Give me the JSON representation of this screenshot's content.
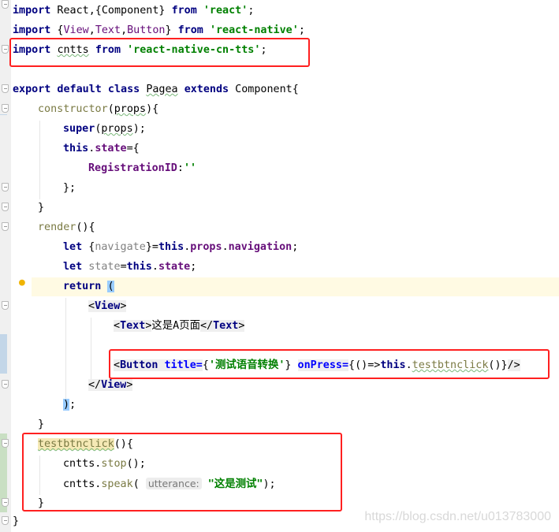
{
  "colors": {
    "keyword": "#000080",
    "string": "#008000",
    "field": "#660e7a",
    "highlight_box": "#ff2020",
    "current_line": "#fffae3"
  },
  "icons": {
    "gutter_hint": "lightbulb-icon",
    "fold": "fold-marker-icon"
  },
  "lines": [
    {
      "indent": 0,
      "tokens": [
        {
          "t": "import",
          "c": "kw"
        },
        {
          "t": " React,{Component} "
        },
        {
          "t": "from",
          "c": "kw"
        },
        {
          "t": " "
        },
        {
          "t": "'react'",
          "c": "str"
        },
        {
          "t": ";"
        }
      ]
    },
    {
      "indent": 0,
      "tokens": [
        {
          "t": "import",
          "c": "kw"
        },
        {
          "t": " {"
        },
        {
          "t": "View",
          "c": "cls"
        },
        {
          "t": ","
        },
        {
          "t": "Text",
          "c": "cls"
        },
        {
          "t": ","
        },
        {
          "t": "Button",
          "c": "cls"
        },
        {
          "t": "} "
        },
        {
          "t": "from",
          "c": "kw"
        },
        {
          "t": " "
        },
        {
          "t": "'react-native'",
          "c": "str"
        },
        {
          "t": ";"
        }
      ]
    },
    {
      "indent": 0,
      "tokens": [
        {
          "t": "import",
          "c": "kw"
        },
        {
          "t": " "
        },
        {
          "t": "cntts",
          "c": "und"
        },
        {
          "t": " "
        },
        {
          "t": "from",
          "c": "kw"
        },
        {
          "t": " "
        },
        {
          "t": "'react-native-cn-tts'",
          "c": "str"
        },
        {
          "t": ";"
        }
      ]
    },
    {
      "indent": 0,
      "tokens": []
    },
    {
      "indent": 0,
      "tokens": [
        {
          "t": "export default class",
          "c": "kw"
        },
        {
          "t": " "
        },
        {
          "t": "Pagea",
          "c": "und"
        },
        {
          "t": " "
        },
        {
          "t": "extends",
          "c": "kw"
        },
        {
          "t": " Component{"
        }
      ]
    },
    {
      "indent": 1,
      "tokens": [
        {
          "t": "constructor",
          "c": "mth"
        },
        {
          "t": "("
        },
        {
          "t": "props",
          "c": "und"
        },
        {
          "t": "){"
        }
      ]
    },
    {
      "indent": 2,
      "tokens": [
        {
          "t": "super",
          "c": "kw"
        },
        {
          "t": "("
        },
        {
          "t": "props",
          "c": "und"
        },
        {
          "t": ");"
        }
      ]
    },
    {
      "indent": 2,
      "tokens": [
        {
          "t": "this",
          "c": "kw"
        },
        {
          "t": "."
        },
        {
          "t": "state",
          "c": "fld"
        },
        {
          "t": "={"
        }
      ]
    },
    {
      "indent": 3,
      "tokens": [
        {
          "t": "RegistrationID",
          "c": "fld"
        },
        {
          "t": ":"
        },
        {
          "t": "''",
          "c": "str"
        }
      ]
    },
    {
      "indent": 2,
      "tokens": [
        {
          "t": "};"
        }
      ]
    },
    {
      "indent": 1,
      "tokens": [
        {
          "t": "}"
        }
      ]
    },
    {
      "indent": 1,
      "tokens": [
        {
          "t": "render",
          "c": "mth"
        },
        {
          "t": "(){"
        }
      ]
    },
    {
      "indent": 2,
      "tokens": [
        {
          "t": "let",
          "c": "kw"
        },
        {
          "t": " {"
        },
        {
          "t": "navigate",
          "c": "par"
        },
        {
          "t": "}="
        },
        {
          "t": "this",
          "c": "kw"
        },
        {
          "t": "."
        },
        {
          "t": "props",
          "c": "fld"
        },
        {
          "t": "."
        },
        {
          "t": "navigation",
          "c": "fld"
        },
        {
          "t": ";"
        }
      ]
    },
    {
      "indent": 2,
      "tokens": [
        {
          "t": "let",
          "c": "kw"
        },
        {
          "t": " "
        },
        {
          "t": "state",
          "c": "par"
        },
        {
          "t": "="
        },
        {
          "t": "this",
          "c": "kw"
        },
        {
          "t": "."
        },
        {
          "t": "state",
          "c": "fld"
        },
        {
          "t": ";"
        }
      ]
    },
    {
      "indent": 2,
      "tokens": [
        {
          "t": "return",
          "c": "kw"
        },
        {
          "t": " "
        },
        {
          "t": "(",
          "c": "brk"
        }
      ]
    },
    {
      "indent": 3,
      "tokens": [
        {
          "t": "<",
          "c": "tag"
        },
        {
          "t": "View",
          "c": "tagn"
        },
        {
          "t": ">",
          "c": "tag"
        }
      ]
    },
    {
      "indent": 4,
      "tokens": [
        {
          "t": "<",
          "c": "tag"
        },
        {
          "t": "Text",
          "c": "tagn"
        },
        {
          "t": ">",
          "c": "tag"
        },
        {
          "t": "这是A页面"
        },
        {
          "t": "</",
          "c": "tag"
        },
        {
          "t": "Text",
          "c": "tagn"
        },
        {
          "t": ">",
          "c": "tag"
        }
      ]
    },
    {
      "indent": 0,
      "tokens": []
    },
    {
      "indent": 4,
      "tokens": [
        {
          "t": "<",
          "c": "tag"
        },
        {
          "t": "Button",
          "c": "tagn"
        },
        {
          "t": " ",
          "c": "tag"
        },
        {
          "t": "title=",
          "c": "attr"
        },
        {
          "t": "{"
        },
        {
          "t": "'测试语音转换'",
          "c": "str"
        },
        {
          "t": "} "
        },
        {
          "t": "onPress=",
          "c": "attr"
        },
        {
          "t": "{()=>"
        },
        {
          "t": "this",
          "c": "kw"
        },
        {
          "t": "."
        },
        {
          "t": "testbtnclick",
          "c": "mth und"
        },
        {
          "t": "()}"
        },
        {
          "t": "/>",
          "c": "tag"
        }
      ]
    },
    {
      "indent": 3,
      "tokens": [
        {
          "t": "</",
          "c": "tag"
        },
        {
          "t": "View",
          "c": "tagn"
        },
        {
          "t": ">",
          "c": "tag"
        }
      ]
    },
    {
      "indent": 2,
      "tokens": [
        {
          "t": ")",
          "c": "brk"
        },
        {
          "t": ";"
        }
      ]
    },
    {
      "indent": 1,
      "tokens": [
        {
          "t": "}"
        }
      ]
    },
    {
      "indent": 1,
      "tokens": [
        {
          "t": "testbtnclick",
          "c": "decl und"
        },
        {
          "t": "(){"
        }
      ]
    },
    {
      "indent": 2,
      "tokens": [
        {
          "t": "cntts."
        },
        {
          "t": "stop",
          "c": "mth"
        },
        {
          "t": "();"
        }
      ]
    },
    {
      "indent": 2,
      "tokens": [
        {
          "t": "cntts."
        },
        {
          "t": "speak",
          "c": "mth"
        },
        {
          "t": "( "
        },
        {
          "t": "utterance:",
          "c": "hint"
        },
        {
          "t": " "
        },
        {
          "t": "\"这是测试\"",
          "c": "str"
        },
        {
          "t": ");"
        }
      ]
    },
    {
      "indent": 1,
      "tokens": [
        {
          "t": "}"
        }
      ]
    },
    {
      "indent": 0,
      "tokens": [
        {
          "t": "}"
        }
      ]
    }
  ],
  "watermark": "https://blog.csdn.net/u013783000"
}
